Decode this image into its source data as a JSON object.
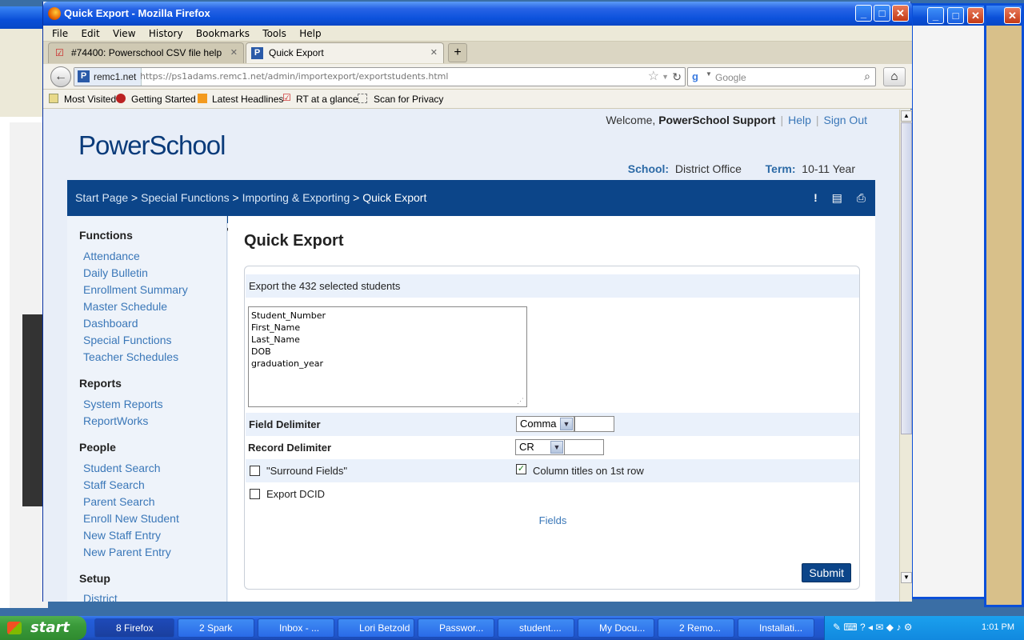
{
  "window": {
    "title": "Quick Export - Mozilla Firefox",
    "menu": [
      "File",
      "Edit",
      "View",
      "History",
      "Bookmarks",
      "Tools",
      "Help"
    ],
    "tabs": [
      {
        "label": "#74400: Powerschool CSV file help",
        "close": "✕"
      },
      {
        "label": "Quick Export",
        "close": "✕"
      }
    ],
    "new_tab": "+",
    "site_identity": "remc1.net",
    "url": "https://ps1adams.remc1.net/admin/importexport/exportstudents.html",
    "search_placeholder": "Google",
    "bookmarks": [
      "Most Visited",
      "Getting Started",
      "Latest Headlines",
      "RT at a glance",
      "Scan for Privacy"
    ]
  },
  "header": {
    "logo": "PowerSchool",
    "welcome_prefix": "Welcome, ",
    "user": "PowerSchool Support",
    "help": "Help",
    "signout": "Sign Out",
    "school_label": "School:",
    "school_value": "District Office",
    "term_label": "Term:",
    "term_value": "10-11 Year"
  },
  "breadcrumb": {
    "items": [
      "Start Page",
      "Special Functions",
      "Importing & Exporting"
    ],
    "separator": ">",
    "current": "Quick Export"
  },
  "sidebar": {
    "sections": [
      {
        "title": "Functions",
        "items": [
          "Attendance",
          "Daily Bulletin",
          "Enrollment Summary",
          "Master Schedule",
          "Dashboard",
          "Special Functions",
          "Teacher Schedules"
        ]
      },
      {
        "title": "Reports",
        "items": [
          "System Reports",
          "ReportWorks"
        ]
      },
      {
        "title": "People",
        "items": [
          "Student Search",
          "Staff Search",
          "Parent Search",
          "Enroll New Student",
          "New Staff Entry",
          "New Parent Entry"
        ]
      },
      {
        "title": "Setup",
        "items": [
          "District"
        ]
      }
    ]
  },
  "main": {
    "title": "Quick Export",
    "export_text": "Export the 432 selected students",
    "fields_text": "Student_Number\nFirst_Name\nLast_Name\nDOB\ngraduation_year",
    "field_delim_label": "Field Delimiter",
    "field_delim_value": "Comma",
    "record_delim_label": "Record Delimiter",
    "record_delim_value": "CR",
    "surround_label": "\"Surround Fields\"",
    "surround_checked": false,
    "coltitles_label": "Column titles on 1st row",
    "coltitles_checked": true,
    "dcid_label": "Export DCID",
    "dcid_checked": false,
    "fields_link": "Fields",
    "submit": "Submit"
  },
  "taskbar": {
    "start": "start",
    "buttons": [
      "8 Firefox",
      "2 Spark",
      "Inbox - ...",
      "Lori Betzold",
      "Passwor...",
      "student....",
      "My Docu...",
      "2 Remo...",
      "Installati..."
    ],
    "clock": "1:01 PM"
  },
  "colors": {
    "brand": "#0c4589",
    "link": "#3a77b8",
    "xp_blue": "#0a4fd8"
  }
}
